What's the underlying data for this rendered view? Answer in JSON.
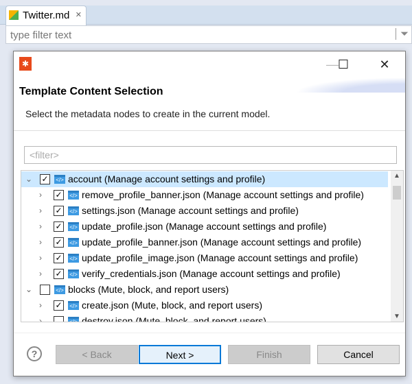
{
  "editor": {
    "tab_label": "Twitter.md",
    "filter_placeholder": "type filter text"
  },
  "dialog": {
    "title": "Template Content Selection",
    "description": "Select the metadata nodes to create in the current model.",
    "filter_placeholder": "<filter>",
    "tree": [
      {
        "label": "account (Manage account settings and profile)",
        "level": 0,
        "expanded": true,
        "checked": true,
        "selected": true
      },
      {
        "label": "remove_profile_banner.json (Manage account settings and profile)",
        "level": 1,
        "checked": true
      },
      {
        "label": "settings.json (Manage account settings and profile)",
        "level": 1,
        "checked": true
      },
      {
        "label": "update_profile.json (Manage account settings and profile)",
        "level": 1,
        "checked": true
      },
      {
        "label": "update_profile_banner.json (Manage account settings and profile)",
        "level": 1,
        "checked": true
      },
      {
        "label": "update_profile_image.json (Manage account settings and profile)",
        "level": 1,
        "checked": true
      },
      {
        "label": "verify_credentials.json (Manage account settings and profile)",
        "level": 1,
        "checked": true
      },
      {
        "label": "blocks (Mute, block, and report users)",
        "level": 0,
        "expanded": true,
        "checked": false
      },
      {
        "label": "create.json (Mute, block, and report users)",
        "level": 1,
        "checked": true
      },
      {
        "label": "destroy.json (Mute, block, and report users)",
        "level": 1,
        "checked": false
      }
    ],
    "buttons": {
      "back": "< Back",
      "next": "Next >",
      "finish": "Finish",
      "cancel": "Cancel"
    }
  }
}
